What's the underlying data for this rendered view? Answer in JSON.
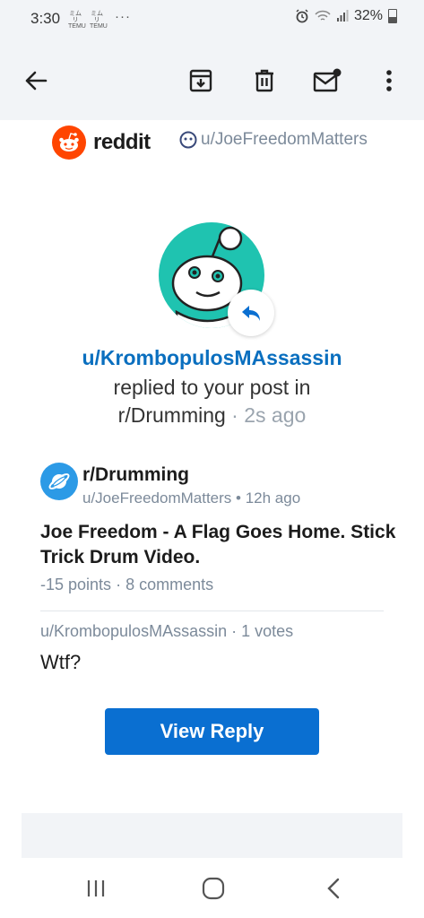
{
  "status_bar": {
    "time": "3:30",
    "notif_icons": [
      {
        "top": "ミムリ",
        "bottom": "TEMU"
      },
      {
        "top": "ミムリ",
        "bottom": "TEMU"
      }
    ],
    "more": "···",
    "battery": "32%"
  },
  "toolbar": {
    "icons": [
      "back-arrow-icon",
      "archive-icon",
      "trash-icon",
      "mark-unread-icon",
      "more-vert-icon"
    ]
  },
  "email": {
    "brand_name": "reddit",
    "recipient": "u/JoeFreedomMatters",
    "replier": "u/KrombopulosMAssassin",
    "action": "replied to your post in",
    "subreddit": "r/Drumming",
    "time_ago": "2s ago",
    "post": {
      "subreddit": "r/Drumming",
      "author": "u/JoeFreedomMatters",
      "posted": "12h ago",
      "title": "Joe Freedom - A Flag Goes Home. Stick Trick Drum Video.",
      "points": "-15 points",
      "comments": "8 comments"
    },
    "comment": {
      "author": "u/KrombopulosMAssassin",
      "votes": "1 votes",
      "body": "Wtf?"
    },
    "button_label": "View Reply",
    "colors": {
      "reddit_orange": "#ff4500",
      "link_blue": "#0a6fbf",
      "button_blue": "#0a6fd1",
      "avatar_teal": "#1fc3b0"
    }
  },
  "navbar": {
    "icons": [
      "recent-apps-icon",
      "home-icon",
      "back-icon"
    ]
  }
}
